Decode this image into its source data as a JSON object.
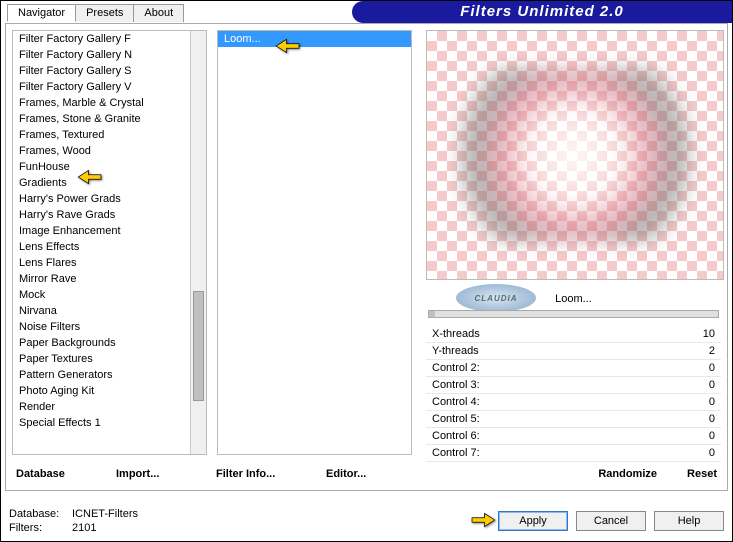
{
  "title": "Filters Unlimited 2.0",
  "tabs": [
    "Navigator",
    "Presets",
    "About"
  ],
  "active_tab": 0,
  "categories": [
    "Filter Factory Gallery F",
    "Filter Factory Gallery N",
    "Filter Factory Gallery S",
    "Filter Factory Gallery V",
    "Frames, Marble & Crystal",
    "Frames, Stone & Granite",
    "Frames, Textured",
    "Frames, Wood",
    "FunHouse",
    "Gradients",
    "Harry's Power Grads",
    "Harry's Rave Grads",
    "Image Enhancement",
    "Lens Effects",
    "Lens Flares",
    "Mirror Rave",
    "Mock",
    "Nirvana",
    "Noise Filters",
    "Paper Backgrounds",
    "Paper Textures",
    "Pattern Generators",
    "Photo Aging Kit",
    "Render",
    "Special Effects 1"
  ],
  "filters": [
    "Loom..."
  ],
  "selected_filter": 0,
  "params_title": "Loom...",
  "watermark_text": "CLAUDIA",
  "params": [
    {
      "label": "X-threads",
      "value": "10"
    },
    {
      "label": "Y-threads",
      "value": "2"
    },
    {
      "label": "Control 2:",
      "value": "0"
    },
    {
      "label": "Control 3:",
      "value": "0"
    },
    {
      "label": "Control 4:",
      "value": "0"
    },
    {
      "label": "Control 5:",
      "value": "0"
    },
    {
      "label": "Control 6:",
      "value": "0"
    },
    {
      "label": "Control 7:",
      "value": "0"
    }
  ],
  "bottom_links": [
    "Database",
    "Import...",
    "Filter Info...",
    "Editor..."
  ],
  "right_links": [
    "Randomize",
    "Reset"
  ],
  "status": {
    "db_label": "Database:",
    "db_value": "ICNET-Filters",
    "filters_label": "Filters:",
    "filters_value": "2101"
  },
  "buttons": {
    "apply": "Apply",
    "cancel": "Cancel",
    "help": "Help"
  }
}
